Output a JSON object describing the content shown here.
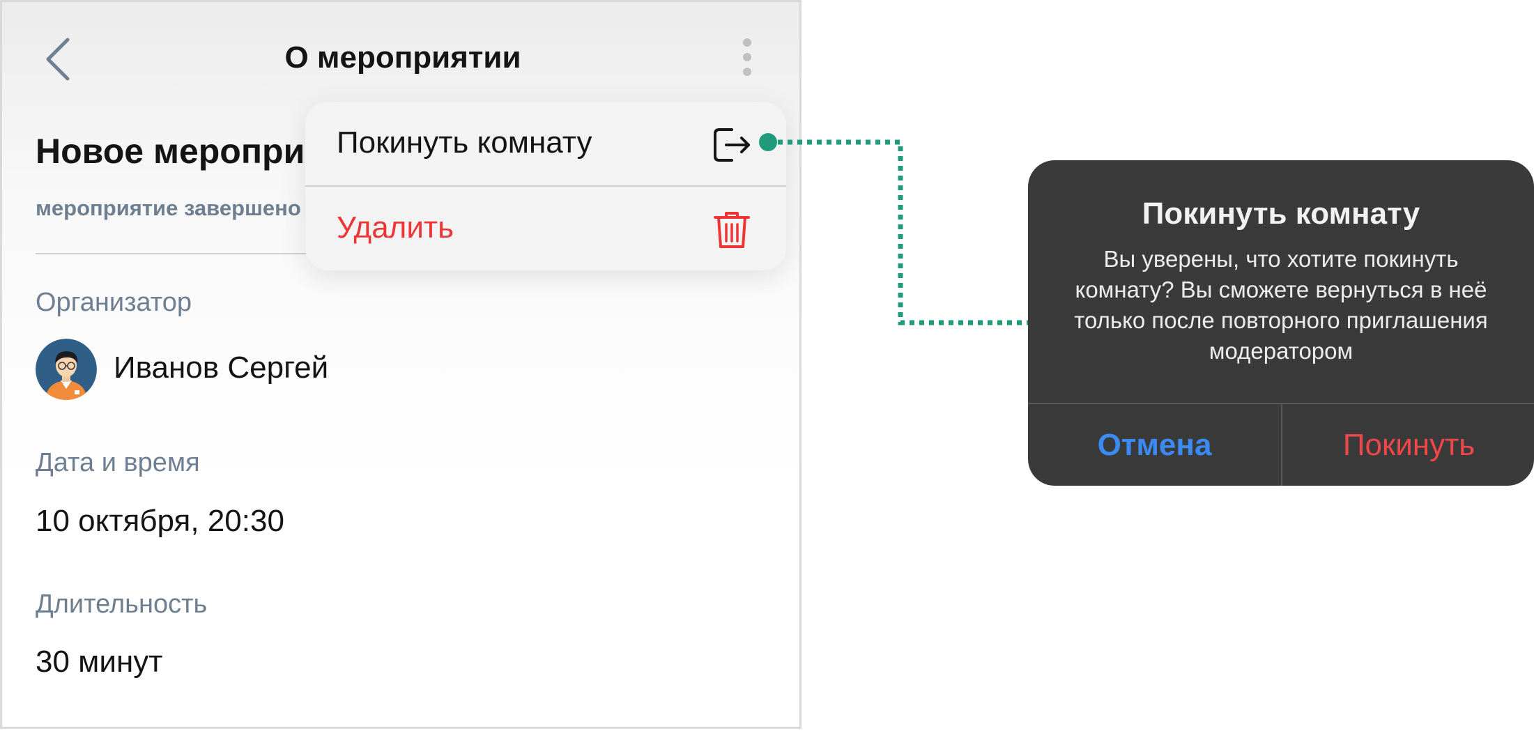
{
  "header": {
    "title": "О мероприятии",
    "back_icon": "chevron-left-icon",
    "more_icon": "more-vertical-icon"
  },
  "event": {
    "title": "Новое мероприятие",
    "status": "мероприятие завершено"
  },
  "organizer": {
    "label": "Организатор",
    "name": "Иванов Сергей"
  },
  "datetime": {
    "label": "Дата и время",
    "value": "10 октября, 20:30"
  },
  "duration": {
    "label": "Длительность",
    "value": "30 минут"
  },
  "menu": {
    "items": [
      {
        "label": "Покинуть комнату",
        "icon": "leave-icon",
        "color": "#141414"
      },
      {
        "label": "Удалить",
        "icon": "trash-icon",
        "color": "#ee3535"
      }
    ]
  },
  "dialog": {
    "title": "Покинуть комнату",
    "message": "Вы уверены, что хотите покинуть комнату? Вы сможете вернуться в неё только после повторного приглашения модератором",
    "cancel_label": "Отмена",
    "confirm_label": "Покинуть"
  },
  "colors": {
    "accent_blue": "#3b8bf5",
    "destructive_red": "#ee3535",
    "connector_green": "#1f9a7a",
    "muted_text": "#6e7f92",
    "dialog_bg": "#3a3a3a"
  }
}
